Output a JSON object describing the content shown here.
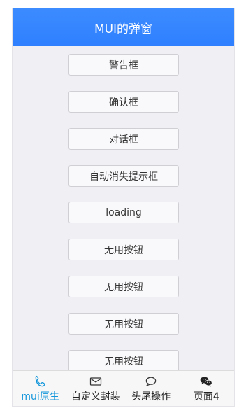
{
  "header": {
    "title": "MUI的弹窗"
  },
  "buttons": [
    "警告框",
    "确认框",
    "对话框",
    "自动消失提示框",
    "loading",
    "无用按钮",
    "无用按钮",
    "无用按钮",
    "无用按钮"
  ],
  "tabbar": {
    "items": [
      {
        "label": "mui原生",
        "icon": "phone-icon",
        "active": true
      },
      {
        "label": "自定义封装",
        "icon": "mail-icon",
        "active": false
      },
      {
        "label": "头尾操作",
        "icon": "chat-bubble-icon",
        "active": false
      },
      {
        "label": "页面4",
        "icon": "wechat-icon",
        "active": false
      }
    ]
  },
  "colors": {
    "header": "#2f80ff",
    "active_tab": "#1296db",
    "background": "#efeff4"
  }
}
